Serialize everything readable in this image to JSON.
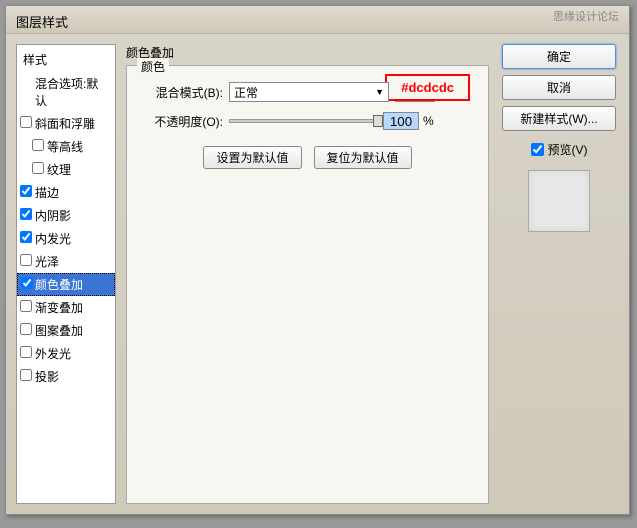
{
  "window": {
    "title": "图层样式"
  },
  "watermark": {
    "line1": "思缘设计论坛",
    "line2": ""
  },
  "sidebar": {
    "header": "样式",
    "blend_options": "混合选项:默认",
    "items": [
      {
        "label": "斜面和浮雕",
        "checked": false
      },
      {
        "label": "等高线",
        "checked": false
      },
      {
        "label": "纹理",
        "checked": false
      },
      {
        "label": "描边",
        "checked": true
      },
      {
        "label": "内阴影",
        "checked": true
      },
      {
        "label": "内发光",
        "checked": true
      },
      {
        "label": "光泽",
        "checked": false
      },
      {
        "label": "颜色叠加",
        "checked": true
      },
      {
        "label": "渐变叠加",
        "checked": false
      },
      {
        "label": "图案叠加",
        "checked": false
      },
      {
        "label": "外发光",
        "checked": false
      },
      {
        "label": "投影",
        "checked": false
      }
    ]
  },
  "main": {
    "title": "颜色叠加",
    "fieldset_legend": "颜色",
    "annotation": "#dcdcdc",
    "blend_mode_label": "混合模式(B):",
    "blend_mode_value": "正常",
    "opacity_label": "不透明度(O):",
    "opacity_value": "100",
    "opacity_unit": "%",
    "btn_default": "设置为默认值",
    "btn_reset": "复位为默认值"
  },
  "right": {
    "ok": "确定",
    "cancel": "取消",
    "new_style": "新建样式(W)...",
    "preview_label": "预览(V)"
  }
}
